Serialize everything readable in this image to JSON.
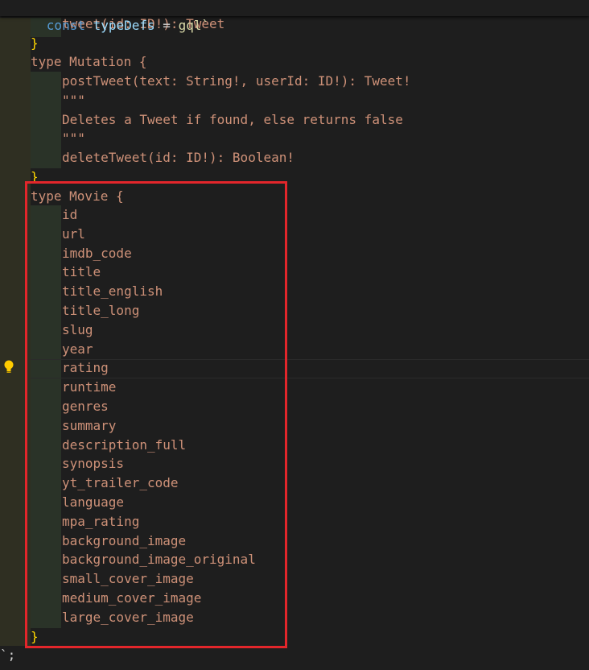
{
  "sticky": {
    "decl_kw": "const",
    "decl_name": "typeDefs",
    "op": " = ",
    "tag": "gql`"
  },
  "lines": {
    "tweet_query": "tweet(id: ID!): Tweet",
    "close1": "}",
    "mutation_kw": "type",
    "mutation_name": " Mutation {",
    "post_tweet": "postTweet(text: String!, userId: ID!): Tweet!",
    "doc_open": "\"\"\"",
    "doc_text": "Deletes a Tweet if found, else returns false",
    "doc_close": "\"\"\"",
    "delete_tweet": "deleteTweet(id: ID!): Boolean!",
    "close2": "}",
    "movie_kw": "type",
    "movie_name": " Movie {",
    "close3": "}",
    "end": "`;"
  },
  "movie_fields": [
    "id",
    "url",
    "imdb_code",
    "title",
    "title_english",
    "title_long",
    "slug",
    "year",
    "rating",
    "runtime",
    "genres",
    "summary",
    "description_full",
    "synopsis",
    "yt_trailer_code",
    "language",
    "mpa_rating",
    "background_image",
    "background_image_original",
    "small_cover_image",
    "medium_cover_image",
    "large_cover_image"
  ],
  "colors": {
    "highlight_border": "#e3262b",
    "keyword": "#569cd6",
    "string": "#ce9178"
  },
  "icons": {
    "gutter": "lightbulb-icon"
  }
}
